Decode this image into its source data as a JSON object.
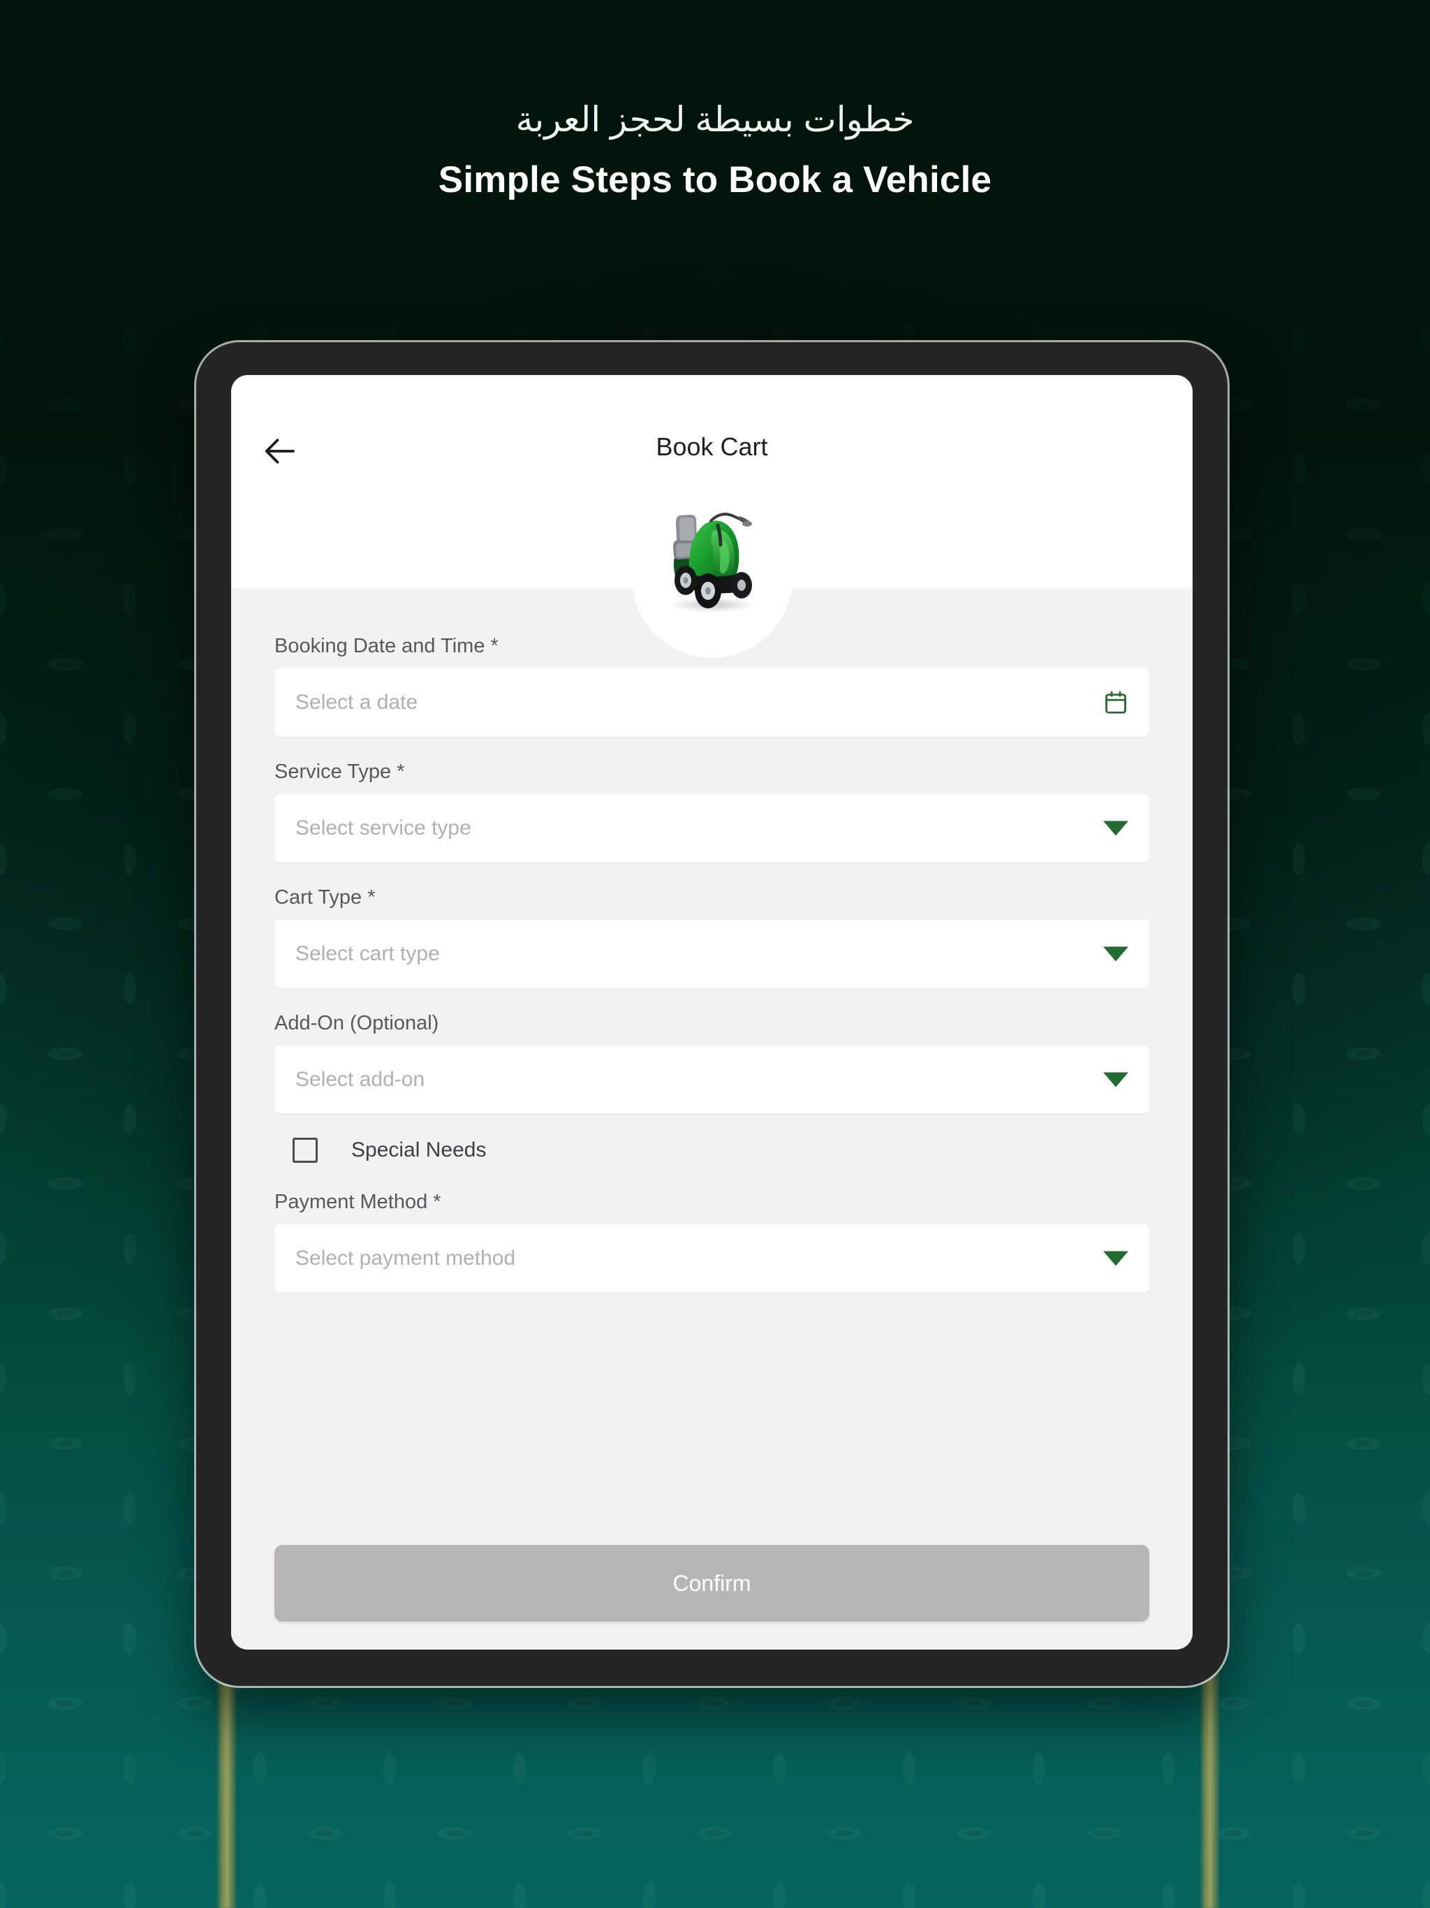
{
  "page": {
    "heading_arabic": "خطوات بسيطة لحجز العربة",
    "heading_english": "Simple Steps to Book a Vehicle"
  },
  "colors": {
    "background_top": "#02150c",
    "background_bottom": "#06655e",
    "accent_green": "#226b31",
    "screen_background": "#f2f2f2",
    "confirm_disabled": "#b7b5b5"
  },
  "app": {
    "header": {
      "back_icon": "arrow-left-icon",
      "title": "Book Cart",
      "hero_image_alt": "green-mobility-scooter"
    },
    "fields": [
      {
        "label": "Booking Date and Time",
        "required_marker": "*",
        "placeholder": "Select a date",
        "icon": "calendar-icon"
      },
      {
        "label": "Service Type",
        "required_marker": "*",
        "placeholder": "Select service type",
        "icon": "chevron-down-icon"
      },
      {
        "label": "Cart Type",
        "required_marker": "*",
        "placeholder": "Select cart type",
        "icon": "chevron-down-icon"
      },
      {
        "label": "Add-On (Optional)",
        "required_marker": "",
        "placeholder": "Select add-on",
        "icon": "chevron-down-icon"
      },
      {
        "label": "Payment Method",
        "required_marker": "*",
        "placeholder": "Select payment method",
        "icon": "chevron-down-icon"
      }
    ],
    "checkbox": {
      "label": "Special Needs",
      "checked": false
    },
    "confirm_label": "Confirm"
  }
}
